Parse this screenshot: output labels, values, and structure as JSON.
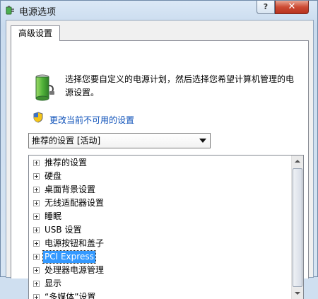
{
  "window": {
    "title": "电源选项",
    "help_label": "?",
    "close_label": "✕"
  },
  "tabs": [
    {
      "label": "高级设置",
      "active": true
    }
  ],
  "main": {
    "description": "选择您要自定义的电源计划，然后选择您希望计算机管理的电源设置。",
    "link_text": "更改当前不可用的设置",
    "plan_select": {
      "value": "推荐的设置 [活动]"
    }
  },
  "tree": {
    "items": [
      {
        "label": "推荐的设置",
        "selected": false
      },
      {
        "label": "硬盘",
        "selected": false
      },
      {
        "label": "桌面背景设置",
        "selected": false
      },
      {
        "label": "无线适配器设置",
        "selected": false
      },
      {
        "label": "睡眠",
        "selected": false
      },
      {
        "label": "USB 设置",
        "selected": false
      },
      {
        "label": "电源按钮和盖子",
        "selected": false
      },
      {
        "label": "PCI Express",
        "selected": true
      },
      {
        "label": "处理器电源管理",
        "selected": false
      },
      {
        "label": "显示",
        "selected": false
      },
      {
        "label": "“多媒体”设置",
        "selected": false
      }
    ]
  },
  "colors": {
    "link": "#0b4fb8",
    "selection": "#3399ff",
    "close_button": "#cc4a33"
  },
  "icons": {
    "app": "battery-plug-icon",
    "plan": "battery-plan-icon",
    "link": "uac-shield-icon"
  }
}
